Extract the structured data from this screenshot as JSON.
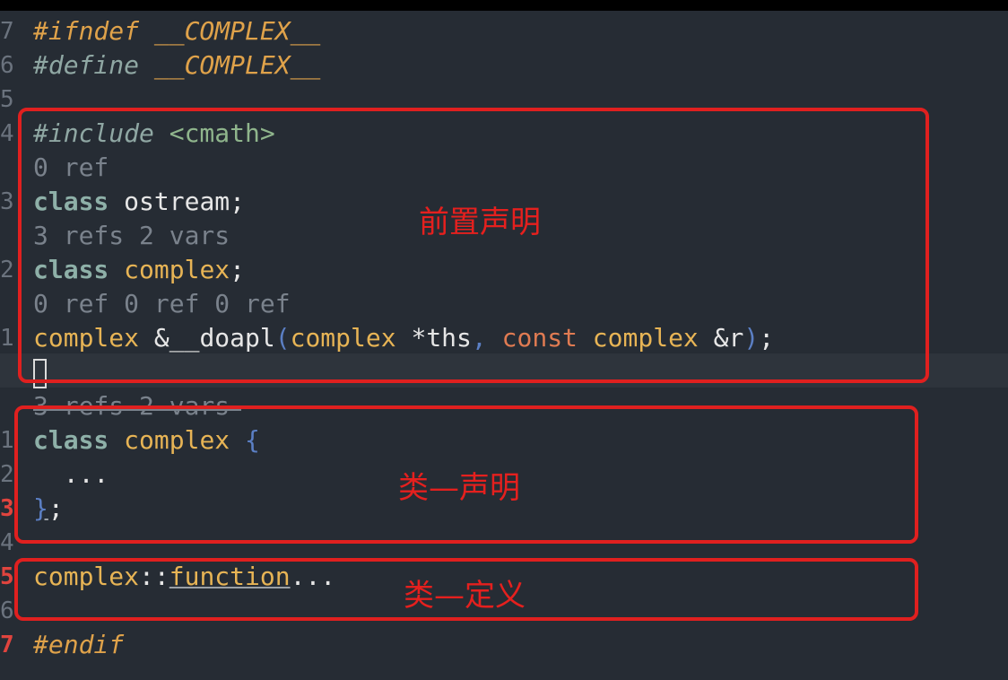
{
  "editor": {
    "lines": [
      {
        "num": "7",
        "segments": [
          [
            "c-pre",
            "#ifndef __COMPLEX__"
          ]
        ]
      },
      {
        "num": "6",
        "segments": [
          [
            "c-pre2",
            "#define "
          ],
          [
            "c-pre",
            "__COMPLEX__"
          ]
        ]
      },
      {
        "num": "5",
        "segments": []
      },
      {
        "num": "4",
        "segments": [
          [
            "c-pre2",
            "#include "
          ],
          [
            "c-inc",
            "<cmath>"
          ]
        ]
      },
      {
        "num": "",
        "segments": [
          [
            "c-gray",
            "0 ref"
          ]
        ]
      },
      {
        "num": "3",
        "segments": [
          [
            "c-kw",
            "class"
          ],
          [
            "c-plain",
            " ostream;"
          ]
        ]
      },
      {
        "num": "",
        "segments": [
          [
            "c-gray",
            "3 refs 2 vars"
          ]
        ]
      },
      {
        "num": "2",
        "segments": [
          [
            "c-kw",
            "class"
          ],
          [
            "c-type",
            " complex"
          ],
          [
            "c-plain",
            ";"
          ]
        ]
      },
      {
        "num": "",
        "segments": [
          [
            "c-gray",
            "0 ref 0 ref 0 ref"
          ]
        ]
      },
      {
        "num": "1",
        "segments": [
          [
            "c-type",
            "complex"
          ],
          [
            "c-plain",
            " &__doapl"
          ],
          [
            "c-paren",
            "("
          ],
          [
            "c-type",
            "complex"
          ],
          [
            "c-plain",
            " *ths"
          ],
          [
            "c-paren",
            ","
          ],
          [
            "c-const",
            " const"
          ],
          [
            "c-type",
            " complex"
          ],
          [
            "c-plain",
            " &r"
          ],
          [
            "c-paren",
            ")"
          ],
          [
            "c-plain",
            ";"
          ]
        ]
      },
      {
        "num": "",
        "segments": [],
        "cursor": true
      },
      {
        "num": "",
        "segments": [
          [
            "c-gray",
            "3 refs 2 vars"
          ]
        ]
      },
      {
        "num": "1",
        "segments": [
          [
            "c-kw",
            "class"
          ],
          [
            "c-type",
            " complex"
          ],
          [
            "c-paren",
            " {"
          ]
        ]
      },
      {
        "num": "2",
        "segments": [
          [
            "c-plain",
            "  ..."
          ]
        ]
      },
      {
        "num": "3",
        "red": true,
        "segments": [
          [
            "c-paren c-under",
            "}"
          ],
          [
            "c-plain",
            ";"
          ]
        ]
      },
      {
        "num": "4",
        "segments": []
      },
      {
        "num": "5",
        "red": true,
        "segments": [
          [
            "c-type",
            "complex"
          ],
          [
            "c-plain",
            "::"
          ],
          [
            "c-type c-under",
            "function"
          ],
          [
            "c-plain",
            "..."
          ]
        ]
      },
      {
        "num": "6",
        "segments": []
      },
      {
        "num": "7",
        "red": true,
        "segments": [
          [
            "c-pre",
            "#endif"
          ]
        ]
      }
    ]
  },
  "annotations": {
    "forward_declaration": "前置声明",
    "class_declaration": "类—声明",
    "class_definition": "类—定义"
  },
  "colors": {
    "annotation_red": "#e0201f",
    "background": "#262c34"
  }
}
